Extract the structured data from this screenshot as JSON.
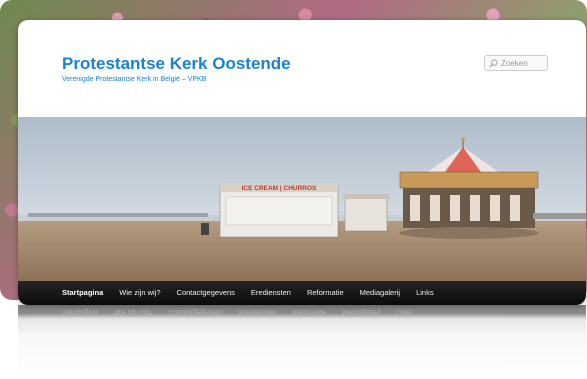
{
  "site": {
    "title": "Protestantse Kerk Oostende",
    "description": "Verenigde Protestantse Kerk in België – VPKB"
  },
  "search": {
    "placeholder": "Zoeken"
  },
  "banner": {
    "booth_sign": "ICE CREAM | CHURROS"
  },
  "nav": {
    "items": [
      {
        "label": "Startpagina"
      },
      {
        "label": "Wie zijn wij?"
      },
      {
        "label": "Contactgegevens"
      },
      {
        "label": "Erediensten"
      },
      {
        "label": "Reformatie"
      },
      {
        "label": "Mediagalerij"
      },
      {
        "label": "Links"
      }
    ]
  },
  "colors": {
    "title_blue": "#1982d1",
    "nav_bg": "#111111"
  }
}
